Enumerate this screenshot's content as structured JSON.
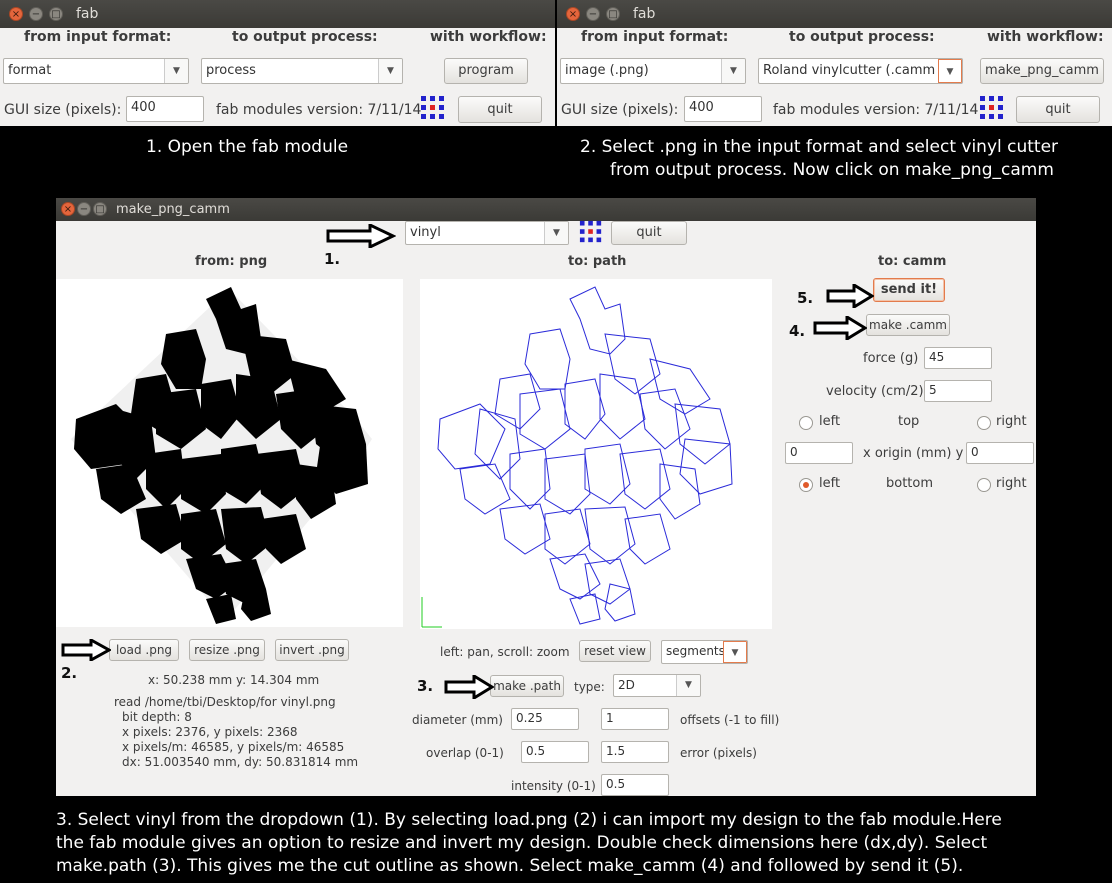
{
  "top_left_window": {
    "title": "fab",
    "from_input_format_label": "from input format:",
    "to_output_process_label": "to output process:",
    "with_workflow_label": "with workflow:",
    "format_value": "format",
    "process_value": "process",
    "program_button": "program",
    "gui_size_label": "GUI size (pixels):",
    "gui_size_value": "400",
    "version_label": "fab modules version: 7/11/14",
    "quit_button": "quit"
  },
  "top_right_window": {
    "title": "fab",
    "from_input_format_label": "from input format:",
    "to_output_process_label": "to output process:",
    "with_workflow_label": "with workflow:",
    "format_value": "image (.png)",
    "process_value": "Roland vinylcutter (.camm",
    "workflow_button": "make_png_camm",
    "gui_size_label": "GUI size (pixels):",
    "gui_size_value": "400",
    "version_label": "fab modules version: 7/11/14",
    "quit_button": "quit"
  },
  "captions": {
    "step1": "1. Open the fab module",
    "step2_line1": "2. Select .png in the input format and select vinyl cutter",
    "step2_line2": "from output process. Now click on make_png_camm",
    "bottom_line1": "3. Select vinyl from the dropdown (1). By selecting load.png (2) i can import my design to the fab module.Here",
    "bottom_line2": "the fab module gives an option to resize and invert my design. Double check dimensions here (dx,dy). Select",
    "bottom_line3": "make.path (3). This gives me the cut outline as shown. Select make_camm (4) and followed by send it (5)."
  },
  "main_window": {
    "title": "make_png_camm",
    "machine_value": "vinyl",
    "quit_button": "quit",
    "from_png_label": "from: png",
    "to_path_label": "to: path",
    "to_camm_label": "to: camm",
    "send_it_button": "send it!",
    "make_camm_button": "make .camm",
    "force_label": "force (g)",
    "force_value": "45",
    "velocity_label": "velocity (cm/2)",
    "velocity_value": "5",
    "left_label": "left",
    "top_label": "top",
    "right_label": "right",
    "origin_x_value": "0",
    "origin_label": "x  origin (mm)  y",
    "origin_y_value": "0",
    "left2_label": "left",
    "bottom_label": "bottom",
    "right2_label": "right",
    "load_png_button": "load .png",
    "resize_png_button": "resize .png",
    "invert_png_button": "invert .png",
    "coords": "x: 50.238 mm  y: 14.304 mm",
    "info_lines": [
      "read /home/tbi/Desktop/for vinyl.png",
      "  bit depth: 8",
      "  x pixels: 2376, y pixels: 2368",
      "  x pixels/m: 46585, y pixels/m: 46585",
      "  dx: 51.003540 mm, dy: 50.831814 mm"
    ],
    "pan_zoom_label": "left: pan, scroll: zoom",
    "reset_view_button": "reset view",
    "segments_value": "segments",
    "make_path_button": "make .path",
    "type_label": "type:",
    "type_value": "2D",
    "diameter_label": "diameter (mm)",
    "diameter_value": "0.25",
    "offsets_value": "1",
    "offsets_label": "offsets (-1 to fill)",
    "overlap_label": "overlap (0-1)",
    "overlap_value": "0.5",
    "error_value": "1.5",
    "error_label": "error (pixels)",
    "intensity_label": "intensity (0-1)",
    "intensity_value": "0.5"
  },
  "annotations": {
    "n1": "1.",
    "n2": "2.",
    "n3": "3.",
    "n4": "4.",
    "n5": "5."
  },
  "colors": {
    "accent_orange": "#e37b4c",
    "path_blue": "#2b2bd9",
    "logo_blue": "#2222cc",
    "logo_red": "#dd2222"
  }
}
